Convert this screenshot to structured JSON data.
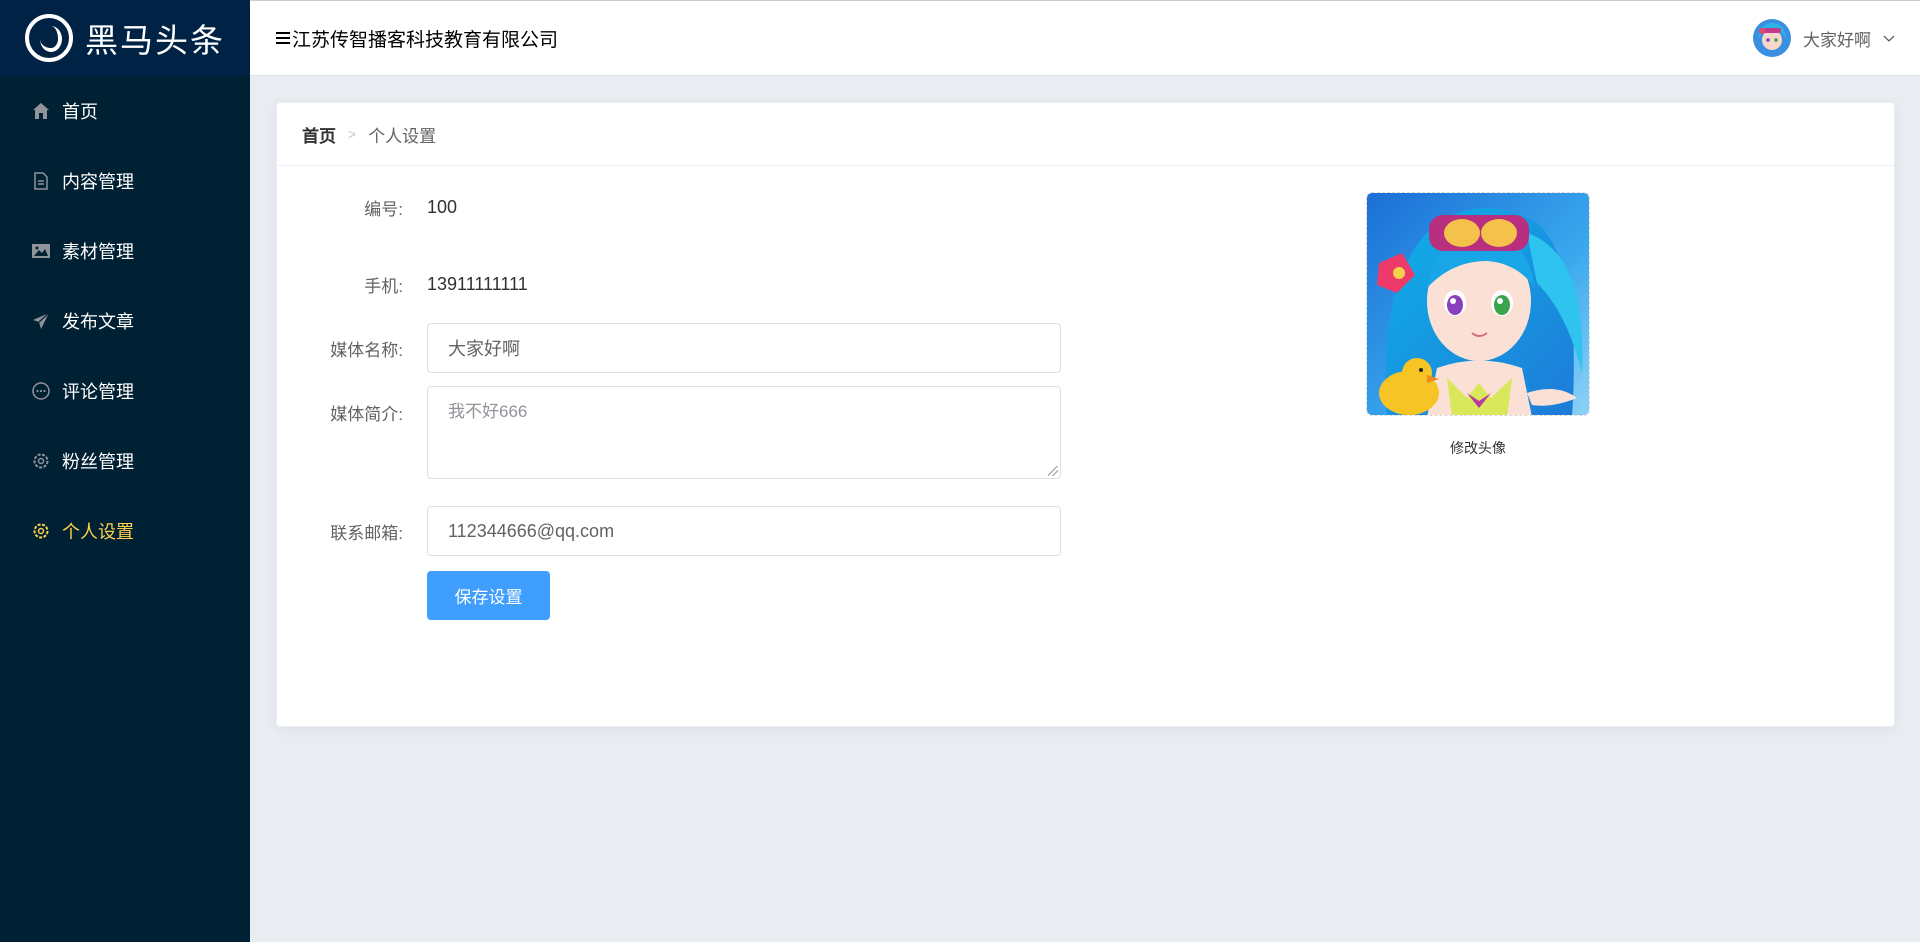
{
  "logo": {
    "text": "黑马头条"
  },
  "sidebar": {
    "items": [
      {
        "label": "首页",
        "icon": "home-icon",
        "active": false
      },
      {
        "label": "内容管理",
        "icon": "document-icon",
        "active": false
      },
      {
        "label": "素材管理",
        "icon": "image-icon",
        "active": false
      },
      {
        "label": "发布文章",
        "icon": "send-icon",
        "active": false
      },
      {
        "label": "评论管理",
        "icon": "comment-icon",
        "active": false
      },
      {
        "label": "粉丝管理",
        "icon": "gear-icon",
        "active": false
      },
      {
        "label": "个人设置",
        "icon": "settings-icon",
        "active": true
      }
    ]
  },
  "header": {
    "company": "江苏传智播客科技教育有限公司",
    "user_name": "大家好啊"
  },
  "breadcrumb": {
    "home": "首页",
    "current": "个人设置"
  },
  "form": {
    "id_label": "编号:",
    "id_value": "100",
    "phone_label": "手机:",
    "phone_value": "13911111111",
    "name_label": "媒体名称:",
    "name_value": "大家好啊",
    "intro_label": "媒体简介:",
    "intro_value": "我不好666",
    "email_label": "联系邮箱:",
    "email_value": "112344666@qq.com",
    "save_label": "保存设置"
  },
  "avatar": {
    "caption": "修改头像"
  },
  "colors": {
    "sidebar_bg": "#002033",
    "active": "#ffd04b",
    "primary": "#409eff"
  }
}
